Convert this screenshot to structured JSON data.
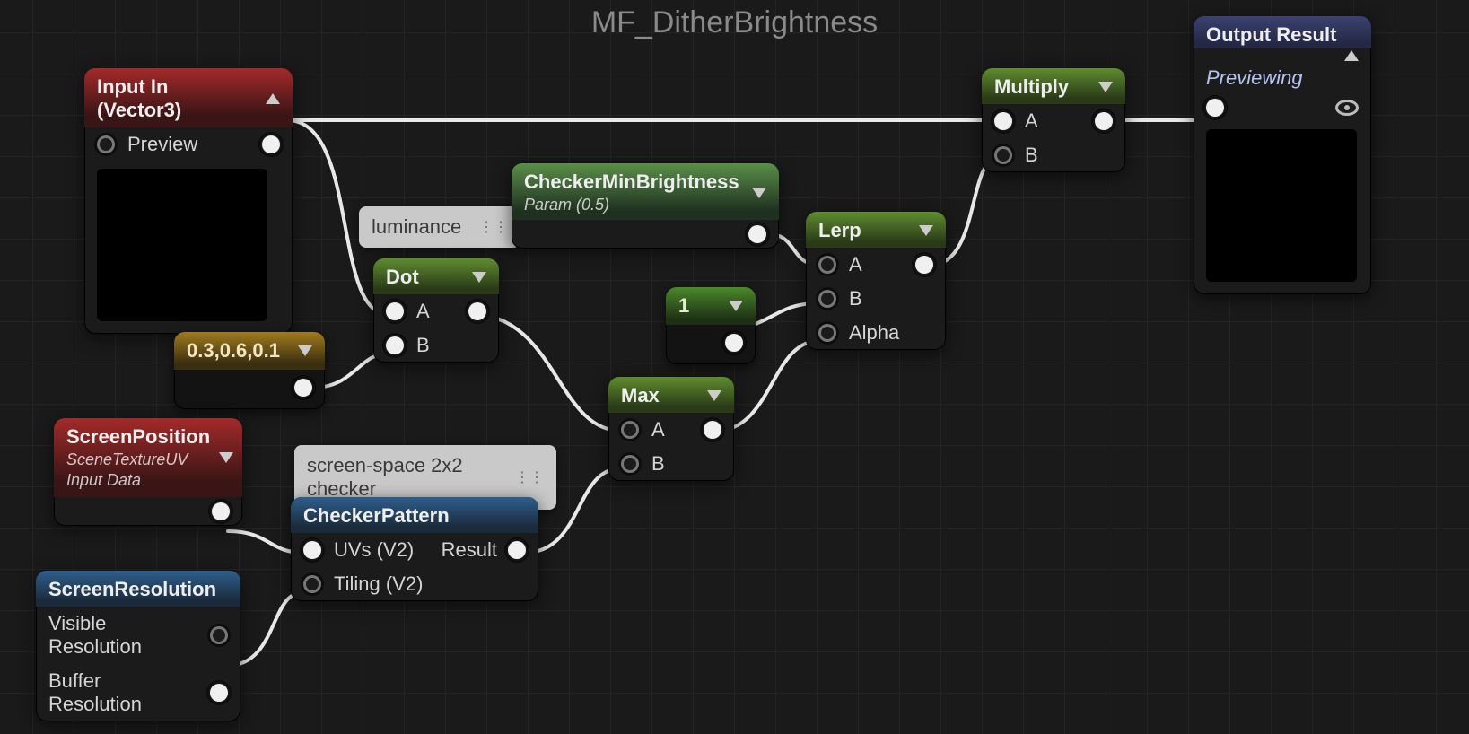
{
  "graph_title": "MF_DitherBrightness",
  "comments": {
    "luminance": "luminance",
    "checker": "screen-space 2x2 checker"
  },
  "nodes": {
    "input_in": {
      "title": "Input In (Vector3)",
      "pin_preview": "Preview"
    },
    "const_lum": {
      "value": "0.3,0.6,0.1"
    },
    "dot": {
      "title": "Dot",
      "a": "A",
      "b": "B"
    },
    "screen_pos": {
      "title": "ScreenPosition",
      "sub1": "SceneTextureUV",
      "sub2": "Input Data"
    },
    "screen_res": {
      "title": "ScreenResolution",
      "out1": "Visible Resolution",
      "out2": "Buffer Resolution"
    },
    "checker_pattern": {
      "title": "CheckerPattern",
      "in1": "UVs (V2)",
      "in2": "Tiling (V2)",
      "out": "Result"
    },
    "checker_min": {
      "title": "CheckerMinBrightness",
      "sub": "Param (0.5)"
    },
    "const_one": {
      "value": "1"
    },
    "max": {
      "title": "Max",
      "a": "A",
      "b": "B"
    },
    "lerp": {
      "title": "Lerp",
      "a": "A",
      "b": "B",
      "alpha": "Alpha"
    },
    "multiply": {
      "title": "Multiply",
      "a": "A",
      "b": "B"
    },
    "output": {
      "title": "Output Result",
      "previewing": "Previewing"
    }
  }
}
